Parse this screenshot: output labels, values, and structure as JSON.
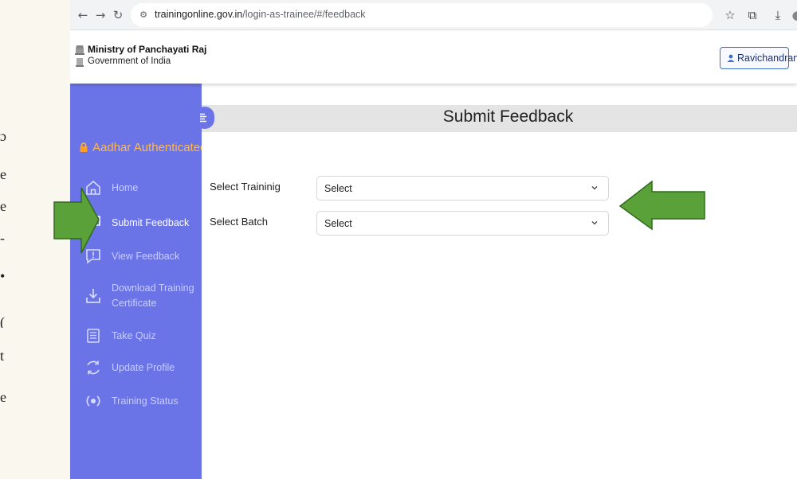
{
  "browser": {
    "url_host": "trainingonline.gov.in",
    "url_path": "/login-as-trainee/#/feedback"
  },
  "header": {
    "ministry": "Ministry of Panchayati Raj",
    "government": "Government of India",
    "user_name": "Ravichandran"
  },
  "sidebar": {
    "status": "Aadhar Authenticated",
    "items": [
      {
        "label": "Home",
        "icon": "home-icon"
      },
      {
        "label": "Submit Feedback",
        "icon": "feedback-icon",
        "active": true
      },
      {
        "label": "View Feedback",
        "icon": "view-feedback-icon"
      },
      {
        "label": "Download Training",
        "label2": "Certificate",
        "icon": "download-icon"
      },
      {
        "label": "Take Quiz",
        "icon": "quiz-icon"
      },
      {
        "label": "Update Profile",
        "icon": "refresh-icon"
      },
      {
        "label": "Training Status",
        "icon": "status-icon"
      }
    ]
  },
  "main": {
    "title": "Submit Feedback",
    "form": {
      "training_label": "Select Traininig",
      "training_value": "Select",
      "batch_label": "Select Batch",
      "batch_value": "Select"
    }
  },
  "colors": {
    "sidebar": "#6a74e6",
    "accent_orange": "#ffb84d",
    "arrow_green": "#5aa13a"
  }
}
